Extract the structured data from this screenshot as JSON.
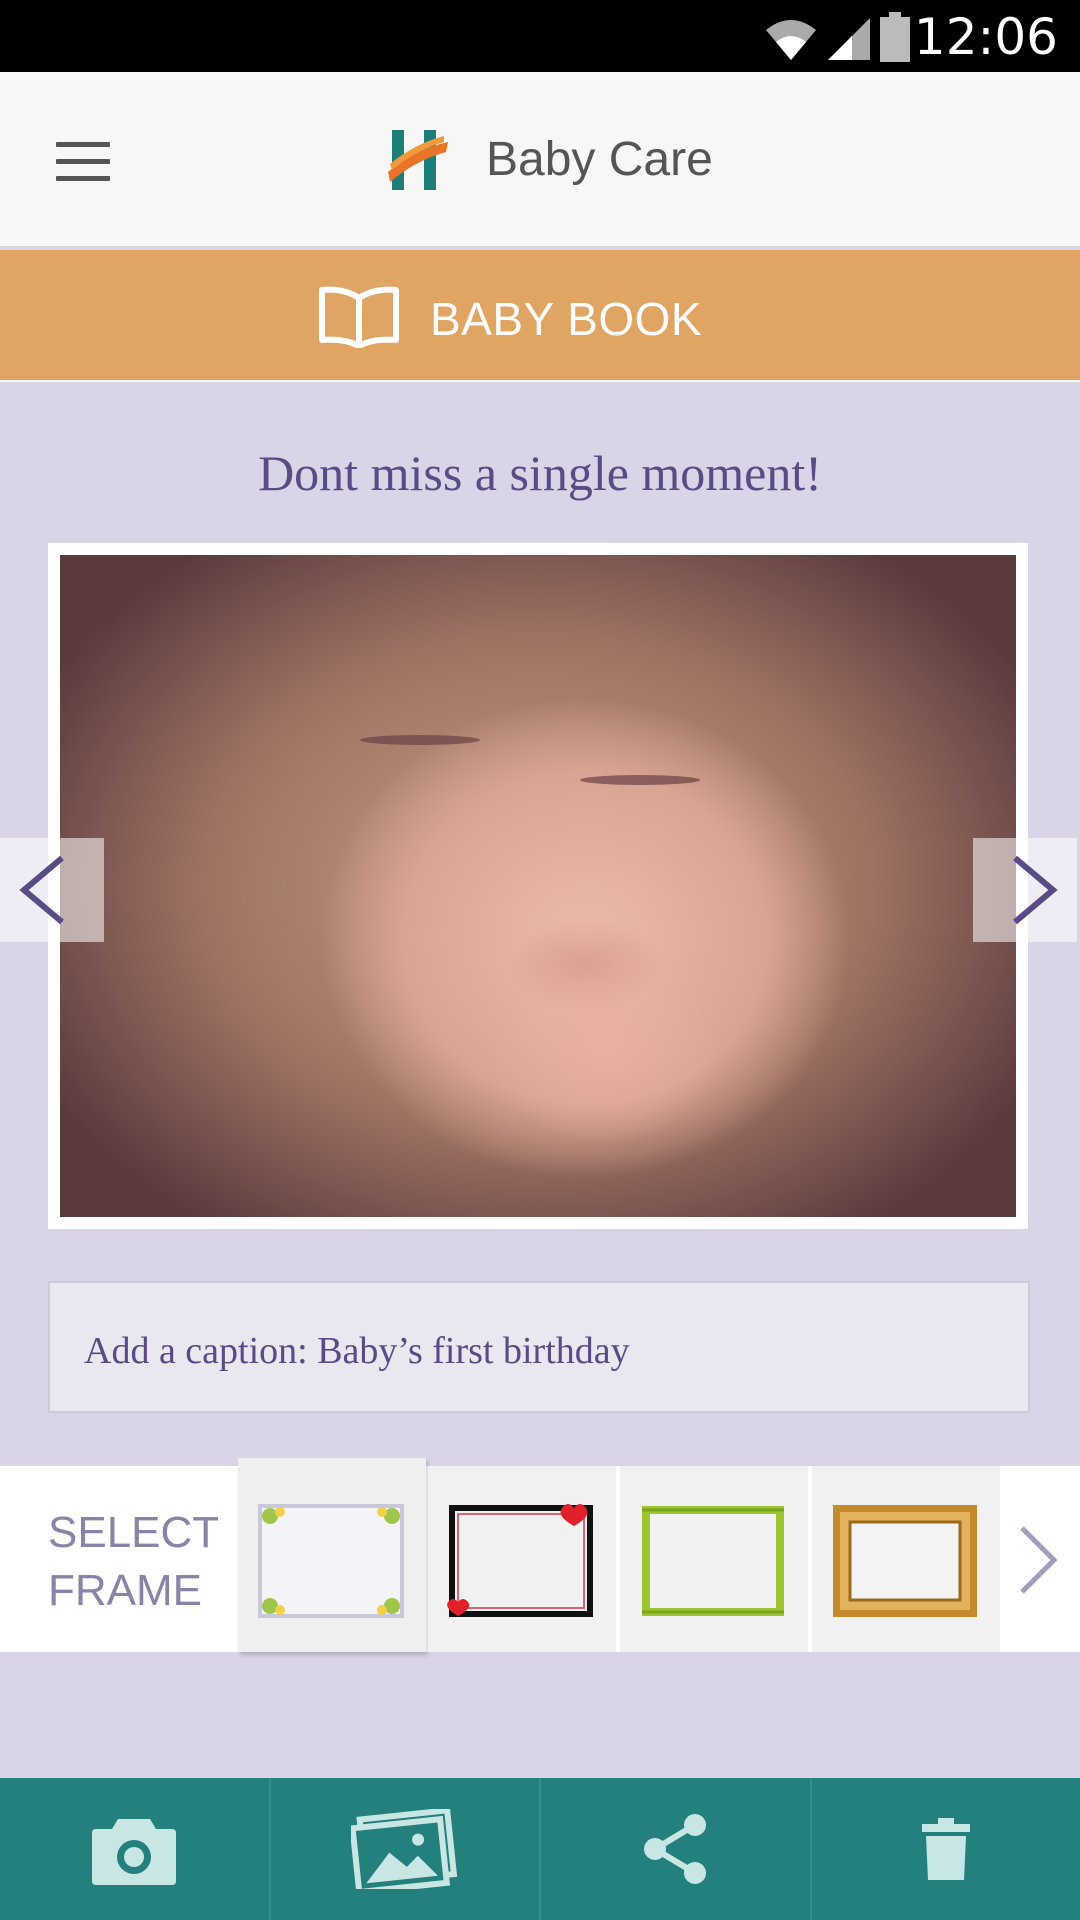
{
  "status_bar": {
    "time": "12:06"
  },
  "app_bar": {
    "title": "Baby Care"
  },
  "section": {
    "label": "BABY BOOK"
  },
  "tagline": "Dont miss a single moment!",
  "caption": {
    "value": "Add a caption: Baby’s first birthday"
  },
  "frame_selector": {
    "label_line1": "SELECT",
    "label_line2": "FRAME",
    "frames": [
      "floral-frame",
      "hearts-frame",
      "bamboo-frame",
      "gold-frame"
    ],
    "selected_index": 0
  },
  "toolbar": {
    "items": [
      "camera-icon",
      "gallery-icon",
      "share-icon",
      "trash-icon"
    ]
  },
  "colors": {
    "accent_orange": "#e0a563",
    "toolbar_teal": "#23807d",
    "background_lavender": "#d9d4e6",
    "text_purple": "#5a4a86"
  }
}
